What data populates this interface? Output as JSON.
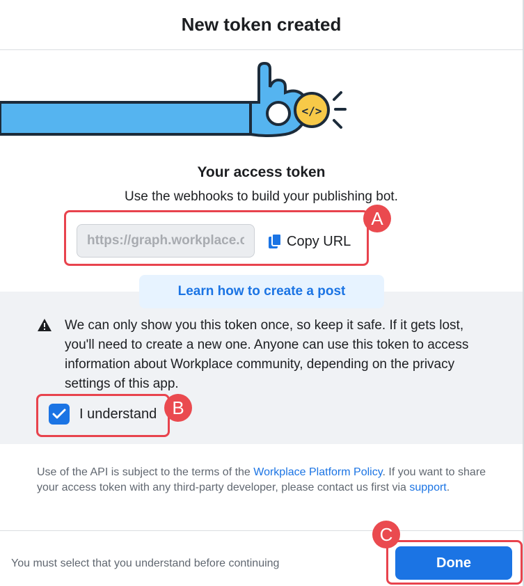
{
  "header": {
    "title": "New token created"
  },
  "token": {
    "title": "Your access token",
    "description": "Use the webhooks to build your publishing bot.",
    "value": "https://graph.workplace.com/",
    "copy_label": "Copy URL"
  },
  "learn": {
    "label": "Learn how to create a post"
  },
  "warning": {
    "text": "We can only show you this token once, so keep it safe. If it gets lost, you'll need to create a new one. Anyone can use this token to access information about Workplace community, depending on the privacy settings of this app.",
    "checkbox_label": "I understand",
    "checked": true
  },
  "legal": {
    "prefix": "Use of the API is subject to the terms of the ",
    "policy_link": "Workplace Platform Policy",
    "middle": ". If you want to share your access token with any third-party developer, please contact us first via ",
    "support_link": "support",
    "suffix": "."
  },
  "footer": {
    "message": "You must select that you understand before continuing",
    "done_label": "Done"
  },
  "annotations": {
    "a": "A",
    "b": "B",
    "c": "C"
  },
  "colors": {
    "primary": "#1b74e4",
    "annotation": "#e8434d",
    "panel": "#f0f2f5",
    "arm": "#55b4f0",
    "coin": "#f7c948"
  }
}
